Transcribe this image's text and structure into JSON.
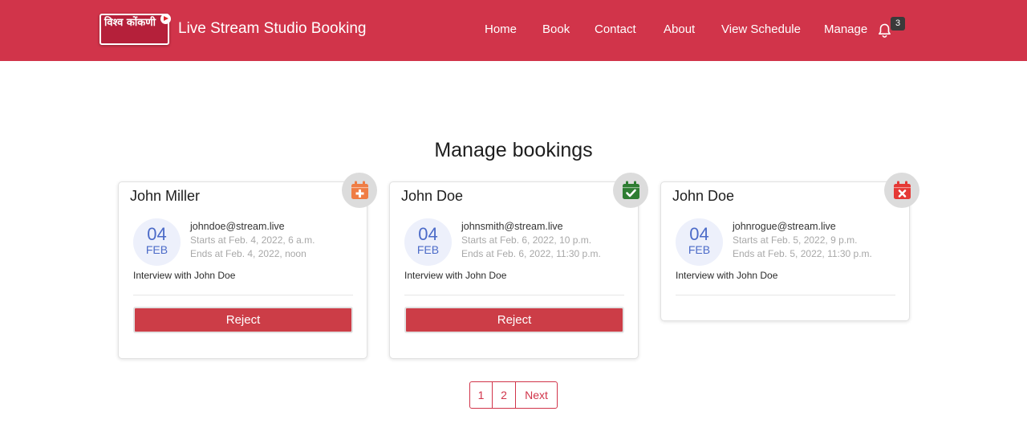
{
  "header": {
    "logo_text": "विश्व कोंकणी",
    "title": "Live Stream Studio Booking",
    "nav": [
      "Home",
      "Book",
      "Contact",
      "About",
      "View Schedule",
      "Manage"
    ],
    "notification_count": "3",
    "bar_color": "#d1344a"
  },
  "main": {
    "title": "Manage bookings",
    "bookings": [
      {
        "name": "John Miller",
        "status_icon": "calendar-plus-icon",
        "status_color": "#ef7d44",
        "day": "04",
        "month": "FEB",
        "email": "johndoe@stream.live",
        "starts": "Starts at Feb. 4, 2022, 6 a.m.",
        "ends": "Ends at Feb. 4, 2022, noon",
        "description": "Interview with John Doe",
        "action_label": "Reject"
      },
      {
        "name": "John Doe",
        "status_icon": "calendar-check-icon",
        "status_color": "#2e7d32",
        "day": "04",
        "month": "FEB",
        "email": "johnsmith@stream.live",
        "starts": "Starts at Feb. 6, 2022, 10 p.m.",
        "ends": "Ends at Feb. 6, 2022, 11:30 p.m.",
        "description": "Interview with John Doe",
        "action_label": "Reject"
      },
      {
        "name": "John Doe",
        "status_icon": "calendar-times-icon",
        "status_color": "#e53935",
        "day": "04",
        "month": "FEB",
        "email": "johnrogue@stream.live",
        "starts": "Starts at Feb. 5, 2022, 9 p.m.",
        "ends": "Ends at Feb. 5, 2022, 11:30 p.m.",
        "description": "Interview with John Doe"
      }
    ]
  },
  "pagination": {
    "pages": [
      "1",
      "2"
    ],
    "next": "Next"
  }
}
